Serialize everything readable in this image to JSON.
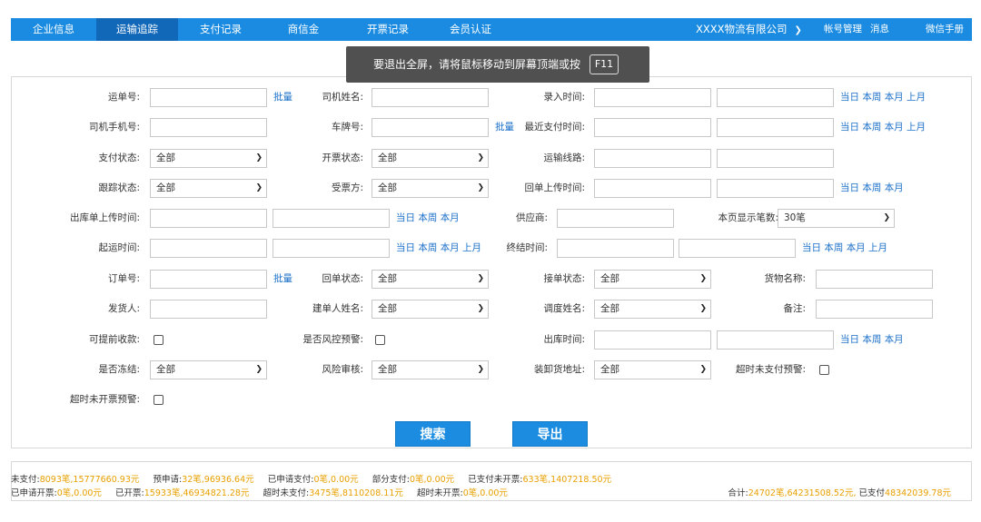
{
  "nav": {
    "tabs": [
      {
        "label": "企业信息",
        "active": false
      },
      {
        "label": "运输追踪",
        "active": true
      },
      {
        "label": "支付记录",
        "active": false
      },
      {
        "label": "商信金",
        "active": false
      },
      {
        "label": "开票记录",
        "active": false
      },
      {
        "label": "会员认证",
        "active": false
      }
    ],
    "company": "XXXX物流有限公司",
    "account": "帐号管理",
    "messages": "消息",
    "manual": "微信手册"
  },
  "toast": {
    "message": "要退出全屏，请将鼠标移动到屏幕顶端或按",
    "key": "F11"
  },
  "form": {
    "waybill_no": "运单号:",
    "batch": "批量",
    "driver_name": "司机姓名:",
    "entry_time": "录入时间:",
    "today": "当日",
    "this_week": "本周",
    "this_month": "本月",
    "last_month": "上月",
    "driver_phone": "司机手机号:",
    "plate_no": "车牌号:",
    "last_pay_time": "最近支付时间:",
    "pay_status": "支付状态:",
    "invoice_status": "开票状态:",
    "route": "运输线路:",
    "track_status": "跟踪状态:",
    "payee": "受票方:",
    "receipt_upload_time": "回单上传时间:",
    "outbound_upload_time": "出库单上传时间:",
    "supplier": "供应商:",
    "page_size": "本页显示笔数:",
    "page_size_value": "30笔",
    "depart_time": "起运时间:",
    "finish_time": "终结时间:",
    "order_no": "订单号:",
    "receipt_status": "回单状态:",
    "accept_status": "接单状态:",
    "goods_name": "货物名称:",
    "shipper": "发货人:",
    "creator_name": "建单人姓名:",
    "dispatcher_name": "调度姓名:",
    "remark": "备注:",
    "early_collect": "可提前收款:",
    "risk_warning": "是否风控预警:",
    "outbound_time": "出库时间:",
    "frozen": "是否冻结:",
    "risk_review": "风险审核:",
    "load_address": "装卸货地址:",
    "unpaid_warning": "超时未支付预警:",
    "uninvoiced_warning": "超时未开票预警:",
    "all": "全部"
  },
  "buttons": {
    "search": "搜索",
    "export": "导出"
  },
  "summary": {
    "unpaid_label": "未支付:",
    "unpaid_value": "8093笔,15777660.93元",
    "pre_apply_label": "预申请:",
    "pre_apply_value": "32笔,96936.64元",
    "applied_pay_label": "已申请支付:",
    "applied_pay_value": "0笔,0.00元",
    "partial_pay_label": "部分支付:",
    "partial_pay_value": "0笔,0.00元",
    "paid_uninvoiced_label": "已支付未开票:",
    "paid_uninvoiced_value": "633笔,1407218.50元",
    "applied_invoice_label": "已申请开票:",
    "applied_invoice_value": "0笔,0.00元",
    "invoiced_label": "已开票:",
    "invoiced_value": "15933笔,46934821.28元",
    "overdue_unpaid_label": "超时未支付:",
    "overdue_unpaid_value": "3475笔,8110208.11元",
    "overdue_uninvoiced_label": "超时未开票:",
    "overdue_uninvoiced_value": "0笔,0.00元",
    "total_label": "合计:",
    "total_value": "24702笔,64231508.52元,",
    "paid_total_label": "已支付",
    "paid_total_value": "48342039.78元"
  },
  "colors": {
    "nav_bg": "#1a8be0",
    "nav_active": "#1167b8",
    "link": "#1a6fc9",
    "highlight": "#e8a000",
    "button": "#1b8ce0"
  }
}
